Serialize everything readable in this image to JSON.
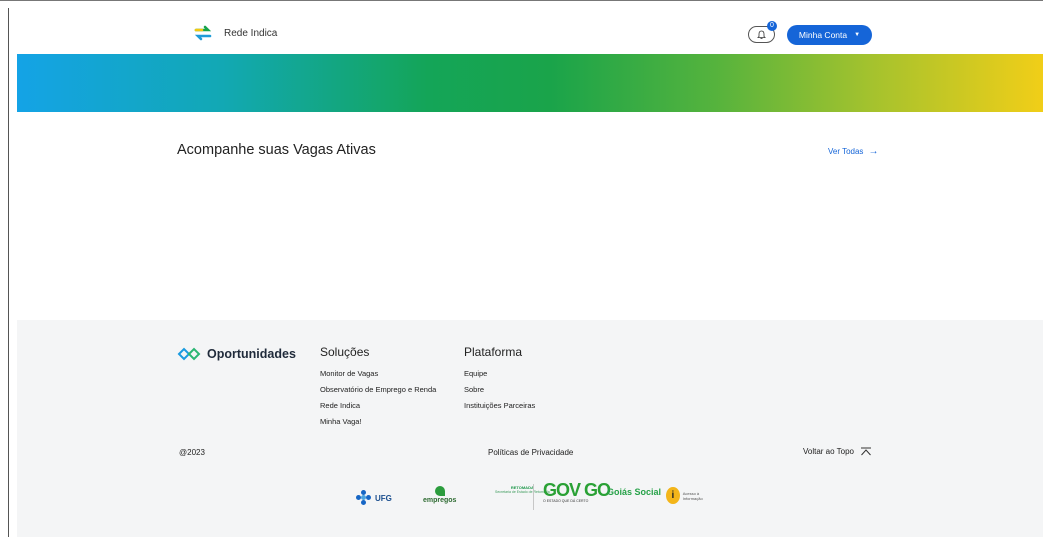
{
  "header": {
    "brand_name": "Rede Indica",
    "notification_count": "0",
    "account_label": "Minha Conta"
  },
  "main": {
    "section_title": "Acompanhe suas Vagas Ativas",
    "see_all_label": "Ver Todas"
  },
  "footer": {
    "logo_text": "Oportunidades",
    "solutions": {
      "title": "Soluções",
      "links": [
        "Monitor de Vagas",
        "Observatório de Emprego e Renda",
        "Rede Indica",
        "Minha Vaga!"
      ]
    },
    "platform": {
      "title": "Plataforma",
      "links": [
        "Equipe",
        "Sobre",
        "Instituições Parceiras"
      ]
    },
    "copyright": "@2023",
    "privacy_label": "Políticas de Privacidade",
    "back_to_top_label": "Voltar ao Topo",
    "partners": {
      "ufg": "UFG",
      "empregos": "empregos",
      "retomada": "RETOMADA",
      "retomada_sub": "Secretaria de Estado de Retomada",
      "gov_go": "GOV GO",
      "gov_sub": "O ESTADO QUE DÁ CERTO",
      "goias_social": "Goiás Social",
      "acesso": "Acesso à Informação"
    }
  },
  "colors": {
    "primary": "#1565d8",
    "footer_bg": "#f4f5f6"
  }
}
